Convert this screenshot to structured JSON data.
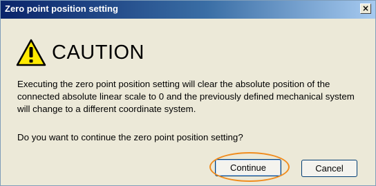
{
  "window": {
    "title": "Zero point position setting",
    "close_glyph": "×"
  },
  "caution": {
    "icon": "warning-triangle-icon",
    "icon_color": "#ffea00",
    "heading": "CAUTION"
  },
  "message": {
    "body": "Executing the zero point position setting will clear the absolute position of the connected absolute linear scale to 0 and the previously defined mechanical system will change to a different coordinate system.",
    "question": "Do you want to continue the zero point position setting?"
  },
  "buttons": {
    "continue_label": "Continue",
    "cancel_label": "Cancel"
  },
  "annotation": {
    "highlight_color": "#f08c1e",
    "highlighted": "continue-button"
  }
}
